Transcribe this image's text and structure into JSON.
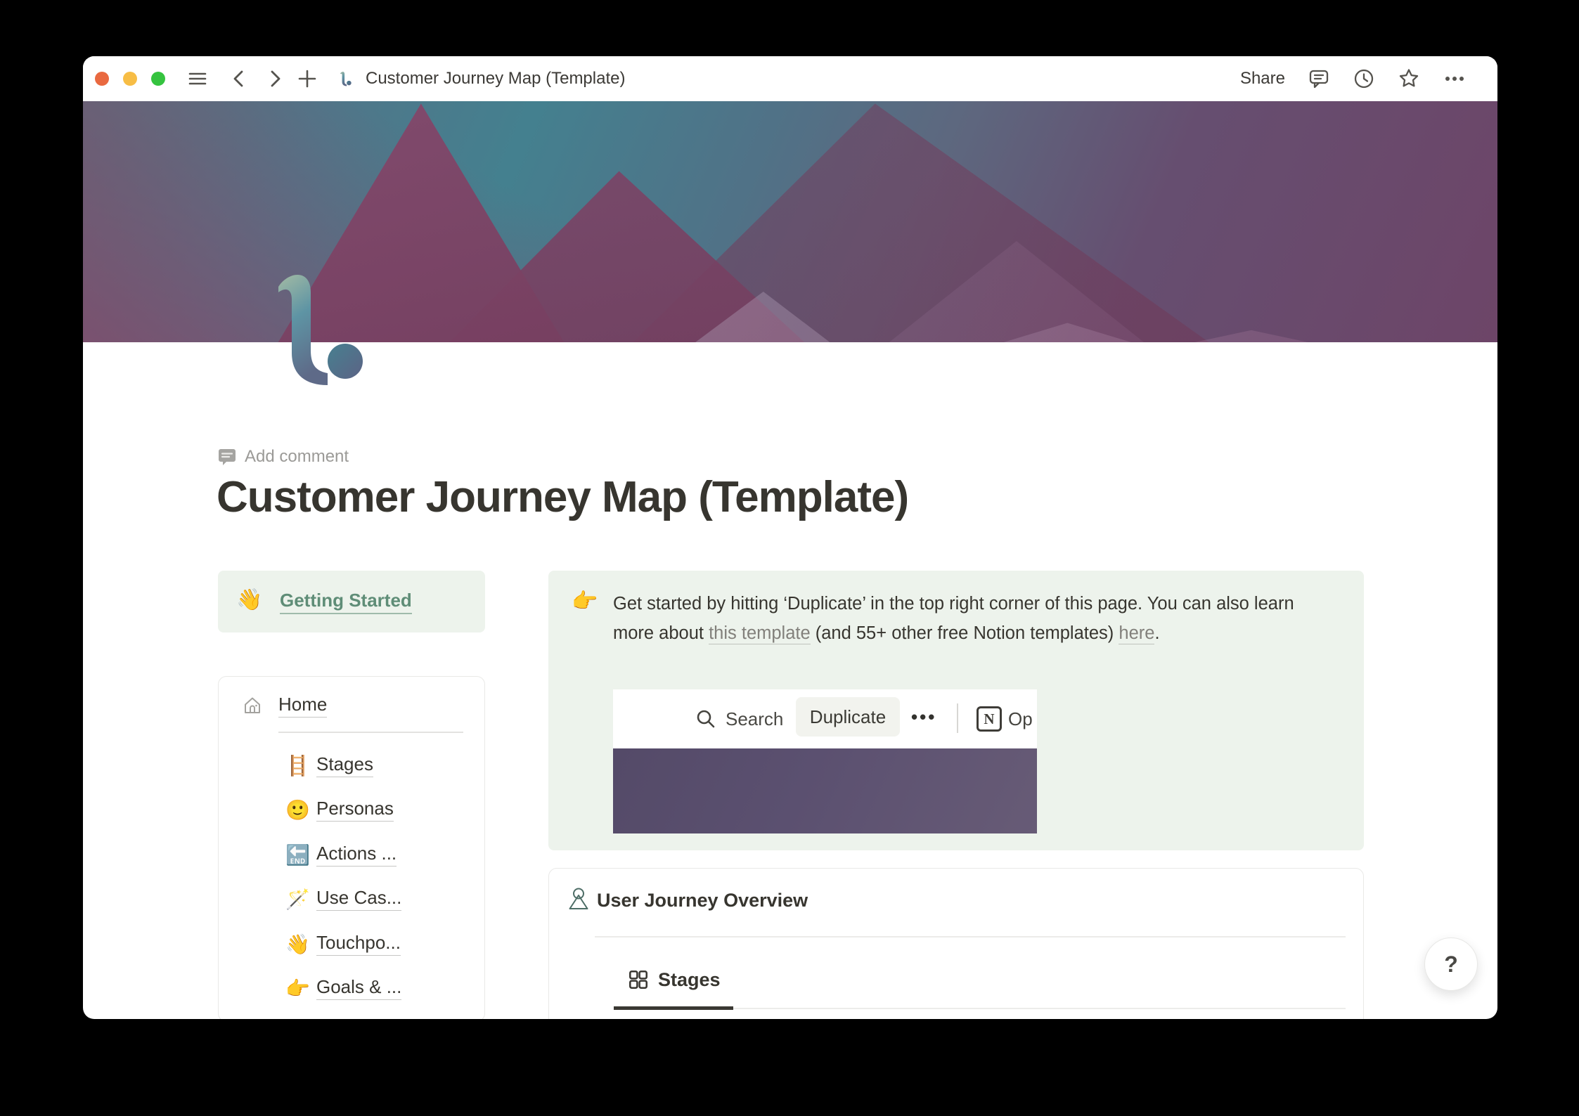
{
  "colors": {
    "text": "#37352f",
    "text-gray": "#9b9a97",
    "link-gray": "#82807b",
    "border": "#e9e9e7",
    "green-bg": "#edf3ec",
    "green-text": "#5f8d77",
    "banner-purple": "#5b5070",
    "cover-teal": "#44808f",
    "cover-plum": "#6d4568",
    "light-red": "#e96940",
    "light-yellow": "#f7bd45",
    "light-green": "#35c33f"
  },
  "titlebar": {
    "title": "Customer Journey Map (Template)",
    "share_label": "Share"
  },
  "page": {
    "add_comment_label": "Add comment",
    "title": "Customer Journey Map (Template)"
  },
  "sidebar": {
    "getting_started": {
      "icon": "👋",
      "label": "Getting Started"
    },
    "home": {
      "label": "Home",
      "items": [
        {
          "icon": "🪜",
          "label": "Stages"
        },
        {
          "icon": "🙂",
          "label": "Personas"
        },
        {
          "icon": "🔚",
          "label": "Actions ..."
        },
        {
          "icon": "🪄",
          "label": "Use Cas..."
        },
        {
          "icon": "👋",
          "label": "Touchpo..."
        },
        {
          "icon": "👉",
          "label": "Goals & ..."
        }
      ]
    }
  },
  "tip": {
    "icon": "👉",
    "text_1": "Get started by hitting ‘Duplicate’ in the top right corner of this page. You can also learn more about ",
    "link_template": "this template",
    "text_2": " (and 55+ other free Notion templates) ",
    "link_here": "here",
    "text_3": ".",
    "screenshot": {
      "search_label": "Search",
      "duplicate_label": "Duplicate",
      "more_label": "•••",
      "notion_logo_letter": "N",
      "open_label": "Op"
    }
  },
  "overview": {
    "title": "User Journey Overview",
    "tab_label": "Stages"
  },
  "help_label": "?"
}
